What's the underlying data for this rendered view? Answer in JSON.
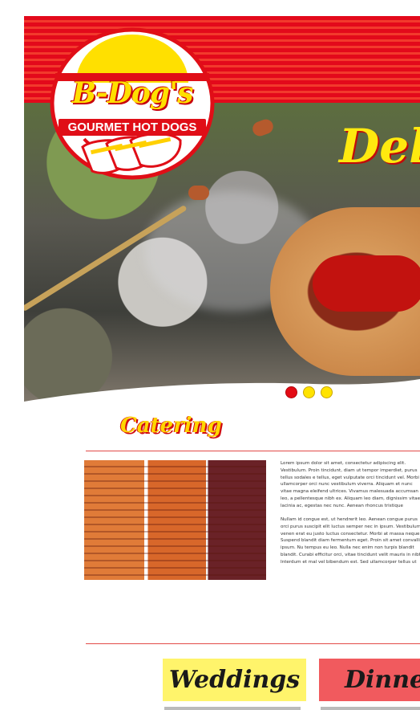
{
  "brand": {
    "name": "B-Dog's",
    "tagline": "GOURMET HOT DOGS"
  },
  "hero": {
    "headline": "Del",
    "carousel_dots": [
      {
        "state": "active",
        "color": "#e30b14"
      },
      {
        "state": "inactive",
        "color": "#ffe300"
      },
      {
        "state": "inactive",
        "color": "#ffe300"
      }
    ]
  },
  "catering": {
    "title": "Catering",
    "paragraph_1": "Lorem ipsum dolor sit amet, consectetur adipiscing elit. Vestibulum. Proin tincidunt, diam ut tempor imperdiet, purus tellus sodales e tellus, eget vulputate orci tincidunt vel. Morbi ullamcorper orci nunc vestibulum viverra. Aliquam et nunc vitae magna eleifend ultrices. Vivamus malesuada accumsan leo, a pellentesque nibh ex. Aliquam leo diam, dignissim vitae lacinia ac, egestas nec nunc. Aenean rhoncus tristique consectetur.",
    "paragraph_2": "Nullam id congue est, ut hendrerit leo. Aenean congue purus orci purus suscipit elit luctus semper nec in ipsum. Vestibulum venen erat eu justo luctus consectetur. Morbi at massa neque. Suspend blandit diam fermentum eget. Proin sit amet convallis ipsum. Nu tempus eu leo. Nulla nec enim non turpis blandit blandit. Curabi efficitur orci, vitae tincidunt velit mauris in nibh. Interdum et mal vel bibendum est. Sed ullamcorper tellus ut orci consequat fauci"
  },
  "cards": [
    {
      "label": "Weddings",
      "color": "#fff46b"
    },
    {
      "label": "Dinner",
      "color": "#f15a5e"
    }
  ],
  "colors": {
    "brand_red": "#e3091b",
    "brand_yellow": "#ffe000"
  }
}
